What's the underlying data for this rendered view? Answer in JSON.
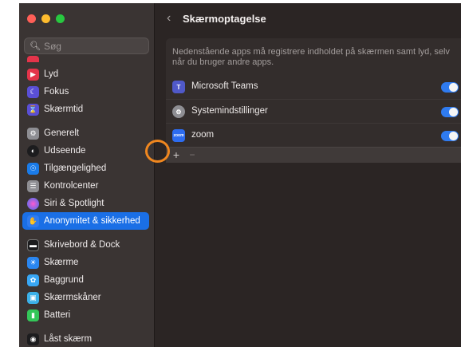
{
  "window": {
    "title": "Skærmoptagelse"
  },
  "sidebar": {
    "search_placeholder": "Søg",
    "items": [
      {
        "label": "Lyd",
        "icon": "speaker-icon",
        "color": "#e4344a"
      },
      {
        "label": "Fokus",
        "icon": "moon-icon",
        "color": "#5a4fd6"
      },
      {
        "label": "Skærmtid",
        "icon": "hourglass-icon",
        "color": "#5a4fd6"
      },
      {
        "label": "Generelt",
        "icon": "gear-icon",
        "color": "#8e8e93"
      },
      {
        "label": "Udseende",
        "icon": "appearance-icon",
        "color": "#1c1c1e"
      },
      {
        "label": "Tilgængelighed",
        "icon": "accessibility-icon",
        "color": "#1a7be8"
      },
      {
        "label": "Kontrolcenter",
        "icon": "control-center-icon",
        "color": "#8e8e93"
      },
      {
        "label": "Siri & Spotlight",
        "icon": "siri-icon",
        "color": "#b03ac9"
      },
      {
        "label": "Anonymitet & sikkerhed",
        "icon": "hand-icon",
        "color": "#2f7bf0"
      },
      {
        "label": "Skrivebord & Dock",
        "icon": "dock-icon",
        "color": "#1c1c1e"
      },
      {
        "label": "Skærme",
        "icon": "sun-icon",
        "color": "#2a86f0"
      },
      {
        "label": "Baggrund",
        "icon": "wallpaper-icon",
        "color": "#38a7f5"
      },
      {
        "label": "Skærmskåner",
        "icon": "screensaver-icon",
        "color": "#3bb0e8"
      },
      {
        "label": "Batteri",
        "icon": "battery-icon",
        "color": "#34c759"
      },
      {
        "label": "Låst skærm",
        "icon": "lock-icon",
        "color": "#1c1c1e"
      }
    ],
    "active": "Anonymitet & sikkerhed"
  },
  "main": {
    "back_icon": "chevron-left-icon",
    "description": "Nedenstående apps må registrere indholdet på skærmen samt lyd, selv når du bruger andre apps.",
    "apps": [
      {
        "name": "Microsoft Teams",
        "icon": "teams-icon",
        "color": "#5059c9",
        "enabled": true
      },
      {
        "name": "Systemindstillinger",
        "icon": "system-settings-icon",
        "color": "#8e8e93",
        "enabled": true
      },
      {
        "name": "zoom",
        "icon": "zoom-icon",
        "color": "#2d6cf0",
        "enabled": true
      }
    ],
    "add_label": "+",
    "remove_label": "−",
    "accent": "#2f7bf0",
    "highlight_color": "#f0871f"
  }
}
